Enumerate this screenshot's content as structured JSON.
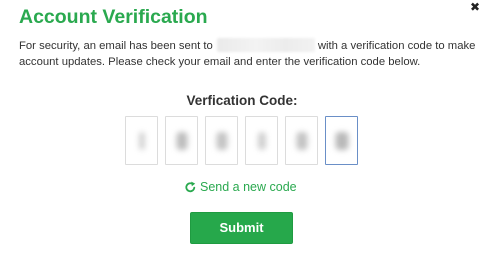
{
  "dialog": {
    "title": "Account Verification",
    "close_icon": "close-icon",
    "description_part1": "For security, an email has been sent to",
    "description_part2": "with a verification code to make",
    "description_line2": "account updates. Please check your email and enter the verification code below."
  },
  "verification": {
    "label": "Verfication Code:",
    "box_count": 6,
    "active_box": 6
  },
  "resend": {
    "icon": "refresh-icon",
    "label": "Send a new code"
  },
  "submit": {
    "label": "Submit"
  },
  "colors": {
    "brand_green": "#2aa94f",
    "button_green": "#26a84b",
    "active_border": "#6a8fc7"
  }
}
